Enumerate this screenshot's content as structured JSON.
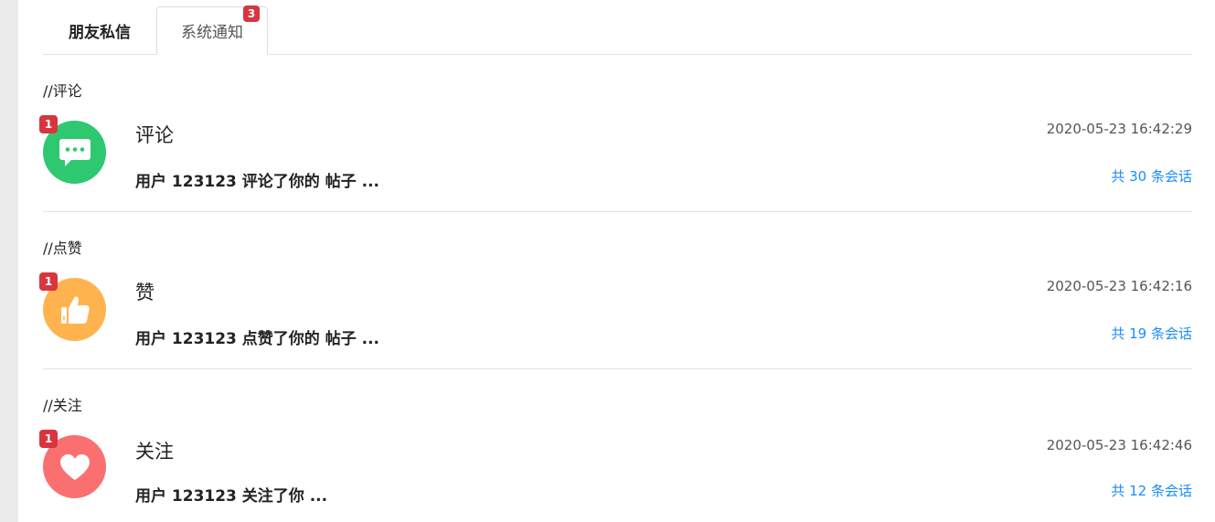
{
  "tabs": {
    "friends_label": "朋友私信",
    "system_label": "系统通知",
    "system_badge": "3"
  },
  "colors": {
    "badge_red": "#d9353f",
    "link_blue": "#1a8cff",
    "comment_green": "#2ec871",
    "like_orange": "#ffb34f",
    "follow_red": "#fa7070"
  },
  "sections": [
    {
      "title": "//评论",
      "icon": "comment-icon",
      "badge": "1",
      "item_title": "评论",
      "summary": "用户 123123 评论了你的 帖子 ...",
      "time": "2020-05-23 16:42:29",
      "link": "共 30 条会话"
    },
    {
      "title": "//点赞",
      "icon": "thumbs-up-icon",
      "badge": "1",
      "item_title": "赞",
      "summary": "用户 123123 点赞了你的 帖子 ...",
      "time": "2020-05-23 16:42:16",
      "link": "共 19 条会话"
    },
    {
      "title": "//关注",
      "icon": "heart-icon",
      "badge": "1",
      "item_title": "关注",
      "summary": "用户 123123 关注了你 ...",
      "time": "2020-05-23 16:42:46",
      "link": "共 12 条会话"
    }
  ]
}
